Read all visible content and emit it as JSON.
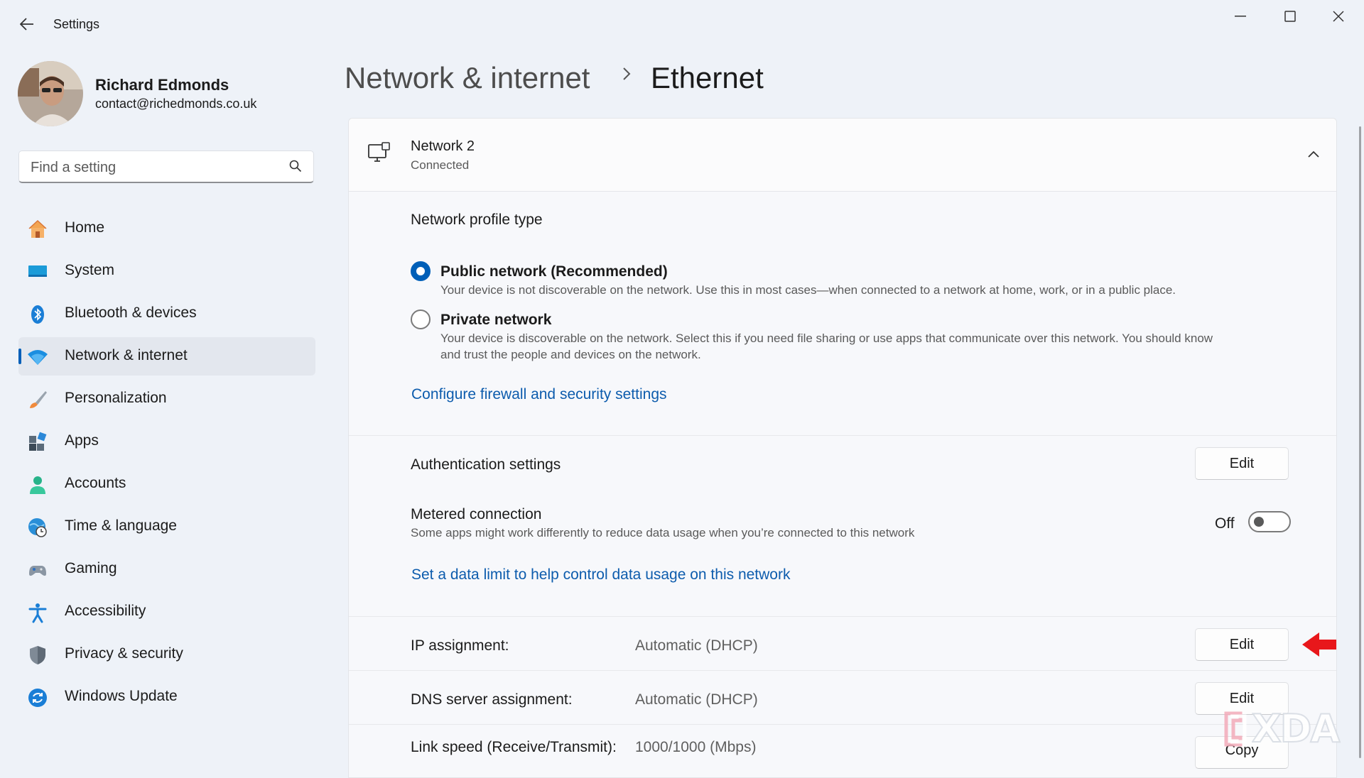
{
  "window": {
    "app_title": "Settings"
  },
  "profile": {
    "name": "Richard Edmonds",
    "email": "contact@richedmonds.co.uk"
  },
  "search": {
    "placeholder": "Find a setting",
    "value": ""
  },
  "nav": {
    "items": [
      {
        "label": "Home",
        "icon": "home-icon"
      },
      {
        "label": "System",
        "icon": "system-icon"
      },
      {
        "label": "Bluetooth & devices",
        "icon": "bluetooth-icon"
      },
      {
        "label": "Network & internet",
        "icon": "wifi-icon",
        "active": true
      },
      {
        "label": "Personalization",
        "icon": "brush-icon"
      },
      {
        "label": "Apps",
        "icon": "apps-icon"
      },
      {
        "label": "Accounts",
        "icon": "accounts-icon"
      },
      {
        "label": "Time & language",
        "icon": "globe-clock-icon"
      },
      {
        "label": "Gaming",
        "icon": "gamepad-icon"
      },
      {
        "label": "Accessibility",
        "icon": "accessibility-icon"
      },
      {
        "label": "Privacy & security",
        "icon": "shield-icon"
      },
      {
        "label": "Windows Update",
        "icon": "update-icon"
      }
    ]
  },
  "header": {
    "breadcrumb_parent": "Network & internet",
    "breadcrumb_current": "Ethernet"
  },
  "network": {
    "name": "Network 2",
    "status": "Connected"
  },
  "profile_type": {
    "heading": "Network profile type",
    "public_label": "Public network (Recommended)",
    "public_desc": "Your device is not discoverable on the network. Use this in most cases—when connected to a network at home, work, or in a public place.",
    "private_label": "Private network",
    "private_desc_line1": "Your device is discoverable on the network. Select this if you need file sharing or use apps that communicate over this network. You should know",
    "private_desc_line2": "and trust the people and devices on the network.",
    "selected": "public",
    "firewall_link": "Configure firewall and security settings"
  },
  "auth": {
    "label": "Authentication settings",
    "button": "Edit"
  },
  "metered": {
    "label": "Metered connection",
    "desc": "Some apps might work differently to reduce data usage when you’re connected to this network",
    "state_label": "Off",
    "on": false,
    "link": "Set a data limit to help control data usage on this network"
  },
  "ip": {
    "label": "IP assignment:",
    "value": "Automatic (DHCP)",
    "button": "Edit"
  },
  "dns": {
    "label": "DNS server assignment:",
    "value": "Automatic (DHCP)",
    "button": "Edit"
  },
  "link_speed": {
    "label": "Link speed (Receive/Transmit):",
    "value": "1000/1000 (Mbps)",
    "button": "Copy"
  },
  "watermark": "XDA",
  "colors": {
    "accent": "#005fb8",
    "link": "#0d5cad",
    "arrow": "#e8171b"
  }
}
